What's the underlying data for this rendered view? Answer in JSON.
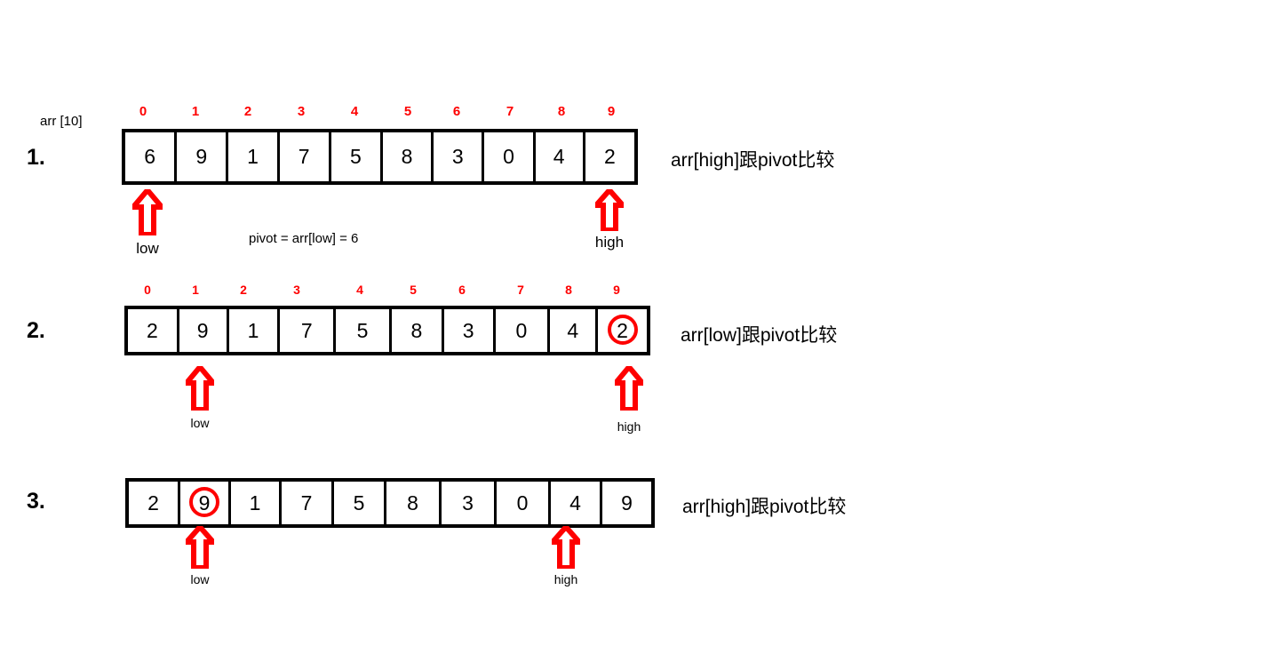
{
  "diagram": {
    "title_label": "arr [10]",
    "pivot_note": "pivot = arr[low] = 6",
    "index_header": [
      "0",
      "1",
      "2",
      "3",
      "4",
      "5",
      "6",
      "7",
      "8",
      "9"
    ],
    "colors": {
      "index_red": "#fe0000",
      "arrow_red": "#fe0000",
      "circle_red": "#fe0000",
      "box_black": "#000000",
      "background": "#ffffff"
    },
    "steps": [
      {
        "number": "1.",
        "values": [
          "6",
          "9",
          "1",
          "7",
          "5",
          "8",
          "3",
          "0",
          "4",
          "2"
        ],
        "indices": [
          "0",
          "1",
          "2",
          "3",
          "4",
          "5",
          "6",
          "7",
          "8",
          "9"
        ],
        "circled_index": null,
        "low_index": 0,
        "high_index": 9,
        "low_label": "low",
        "high_label": "high",
        "caption": "arr[high]跟pivot比较",
        "note": "pivot = arr[low] = 6"
      },
      {
        "number": "2.",
        "values": [
          "2",
          "9",
          "1",
          "7",
          "5",
          "8",
          "3",
          "0",
          "4",
          "2"
        ],
        "indices": [
          "0",
          "1",
          "2",
          "3",
          "4",
          "5",
          "6",
          "7",
          "8",
          "9"
        ],
        "circled_index": 9,
        "low_index": 1,
        "high_index": 9,
        "low_label": "low",
        "high_label": "high",
        "caption": "arr[low]跟pivot比较",
        "note": null
      },
      {
        "number": "3.",
        "values": [
          "2",
          "9",
          "1",
          "7",
          "5",
          "8",
          "3",
          "0",
          "4",
          "9"
        ],
        "indices": null,
        "circled_index": 1,
        "low_index": 1,
        "high_index": 8,
        "low_label": "low",
        "high_label": "high",
        "caption": "arr[high]跟pivot比较",
        "note": null
      }
    ]
  }
}
